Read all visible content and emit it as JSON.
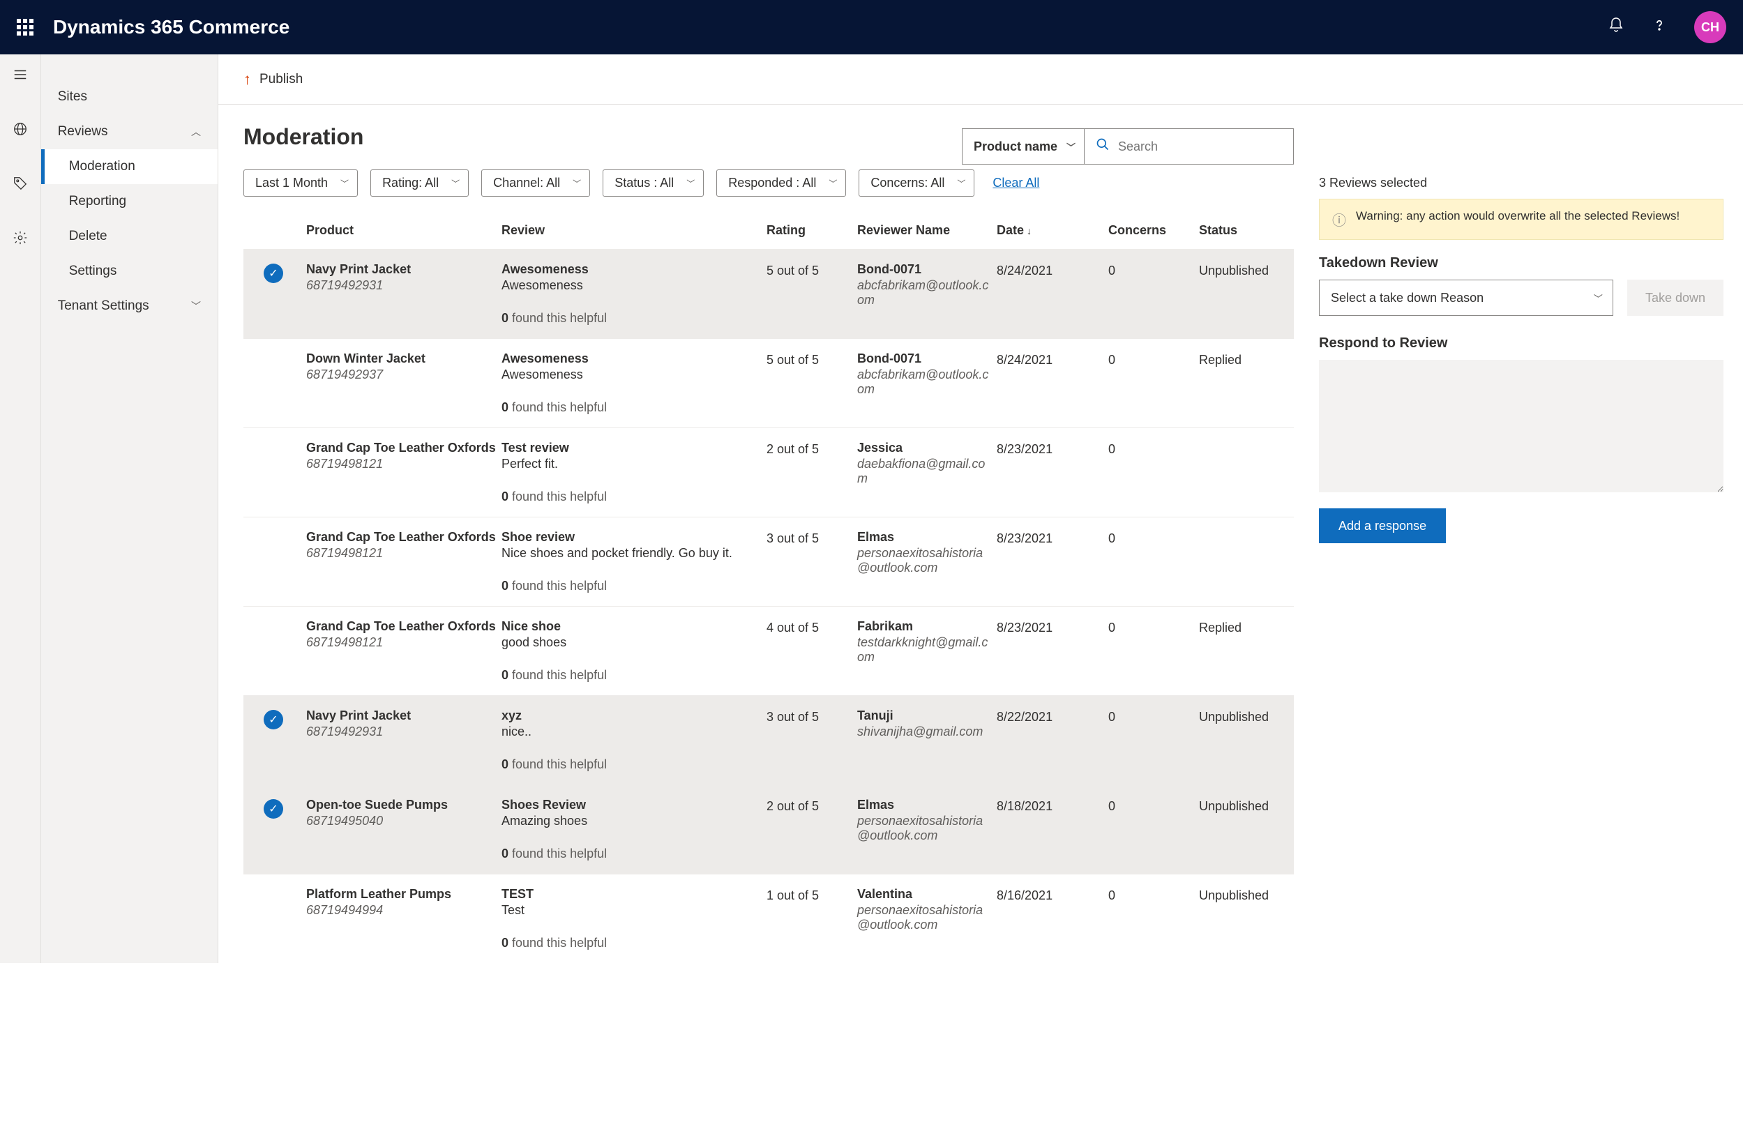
{
  "header": {
    "app_name": "Dynamics 365 Commerce",
    "avatar": "CH"
  },
  "sidebar": {
    "items": [
      "Sites",
      "Reviews",
      "Tenant Settings"
    ],
    "reviews_sub": [
      "Moderation",
      "Reporting",
      "Delete",
      "Settings"
    ]
  },
  "publish": {
    "label": "Publish"
  },
  "page": {
    "title": "Moderation",
    "search_dropdown": "Product name",
    "search_placeholder": "Search",
    "clear_all": "Clear All",
    "filters": [
      "Last 1 Month",
      "Rating: All",
      "Channel: All",
      "Status : All",
      "Responded : All",
      "Concerns: All"
    ]
  },
  "table": {
    "headers": [
      "Product",
      "Review",
      "Rating",
      "Reviewer Name",
      "Date",
      "Concerns",
      "Status"
    ],
    "rows": [
      {
        "sel": true,
        "product": "Navy Print Jacket",
        "pid": "68719492931",
        "rtitle": "Awesomeness",
        "rbody": "Awesomeness",
        "helpful": "0",
        "rating": "5 out of 5",
        "rvname": "Bond-0071",
        "rvmail": "abcfabrikam@outlook.com",
        "date": "8/24/2021",
        "concerns": "0",
        "status": "Unpublished"
      },
      {
        "sel": false,
        "product": "Down Winter Jacket",
        "pid": "68719492937",
        "rtitle": "Awesomeness",
        "rbody": "Awesomeness",
        "helpful": "0",
        "rating": "5 out of 5",
        "rvname": "Bond-0071",
        "rvmail": "abcfabrikam@outlook.com",
        "date": "8/24/2021",
        "concerns": "0",
        "status": "Replied"
      },
      {
        "sel": false,
        "product": "Grand Cap Toe Leather Oxfords",
        "pid": "68719498121",
        "rtitle": "Test review",
        "rbody": "Perfect fit.",
        "helpful": "0",
        "rating": "2 out of 5",
        "rvname": "Jessica",
        "rvmail": "daebakfiona@gmail.com",
        "date": "8/23/2021",
        "concerns": "0",
        "status": ""
      },
      {
        "sel": false,
        "product": "Grand Cap Toe Leather Oxfords",
        "pid": "68719498121",
        "rtitle": "Shoe review",
        "rbody": "Nice shoes and pocket friendly. Go buy it.",
        "helpful": "0",
        "rating": "3 out of 5",
        "rvname": "Elmas",
        "rvmail": "personaexitosahistoria@outlook.com",
        "date": "8/23/2021",
        "concerns": "0",
        "status": ""
      },
      {
        "sel": false,
        "product": "Grand Cap Toe Leather Oxfords",
        "pid": "68719498121",
        "rtitle": "Nice shoe",
        "rbody": "good shoes",
        "helpful": "0",
        "rating": "4 out of 5",
        "rvname": "Fabrikam",
        "rvmail": "testdarkknight@gmail.com",
        "date": "8/23/2021",
        "concerns": "0",
        "status": "Replied"
      },
      {
        "sel": true,
        "product": "Navy Print Jacket",
        "pid": "68719492931",
        "rtitle": "xyz",
        "rbody": "nice..",
        "helpful": "0",
        "rating": "3 out of 5",
        "rvname": "Tanuji",
        "rvmail": "shivanijha@gmail.com",
        "date": "8/22/2021",
        "concerns": "0",
        "status": "Unpublished"
      },
      {
        "sel": true,
        "product": "Open-toe Suede Pumps",
        "pid": "68719495040",
        "rtitle": "Shoes Review",
        "rbody": "Amazing shoes",
        "helpful": "0",
        "rating": "2 out of 5",
        "rvname": "Elmas",
        "rvmail": "personaexitosahistoria@outlook.com",
        "date": "8/18/2021",
        "concerns": "0",
        "status": "Unpublished"
      },
      {
        "sel": false,
        "product": "Platform Leather Pumps",
        "pid": "68719494994",
        "rtitle": "TEST",
        "rbody": "Test",
        "helpful": "0",
        "rating": "1 out of 5",
        "rvname": "Valentina",
        "rvmail": "personaexitosahistoria@outlook.com",
        "date": "8/16/2021",
        "concerns": "0",
        "status": "Unpublished"
      }
    ],
    "helpful_suffix": " found this helpful"
  },
  "right": {
    "selected_text": "3 Reviews selected",
    "warning": "Warning: any action would overwrite all the selected Reviews!",
    "takedown_title": "Takedown Review",
    "takedown_placeholder": "Select a take down Reason",
    "takedown_button": "Take down",
    "respond_title": "Respond to Review",
    "respond_button": "Add a response"
  }
}
